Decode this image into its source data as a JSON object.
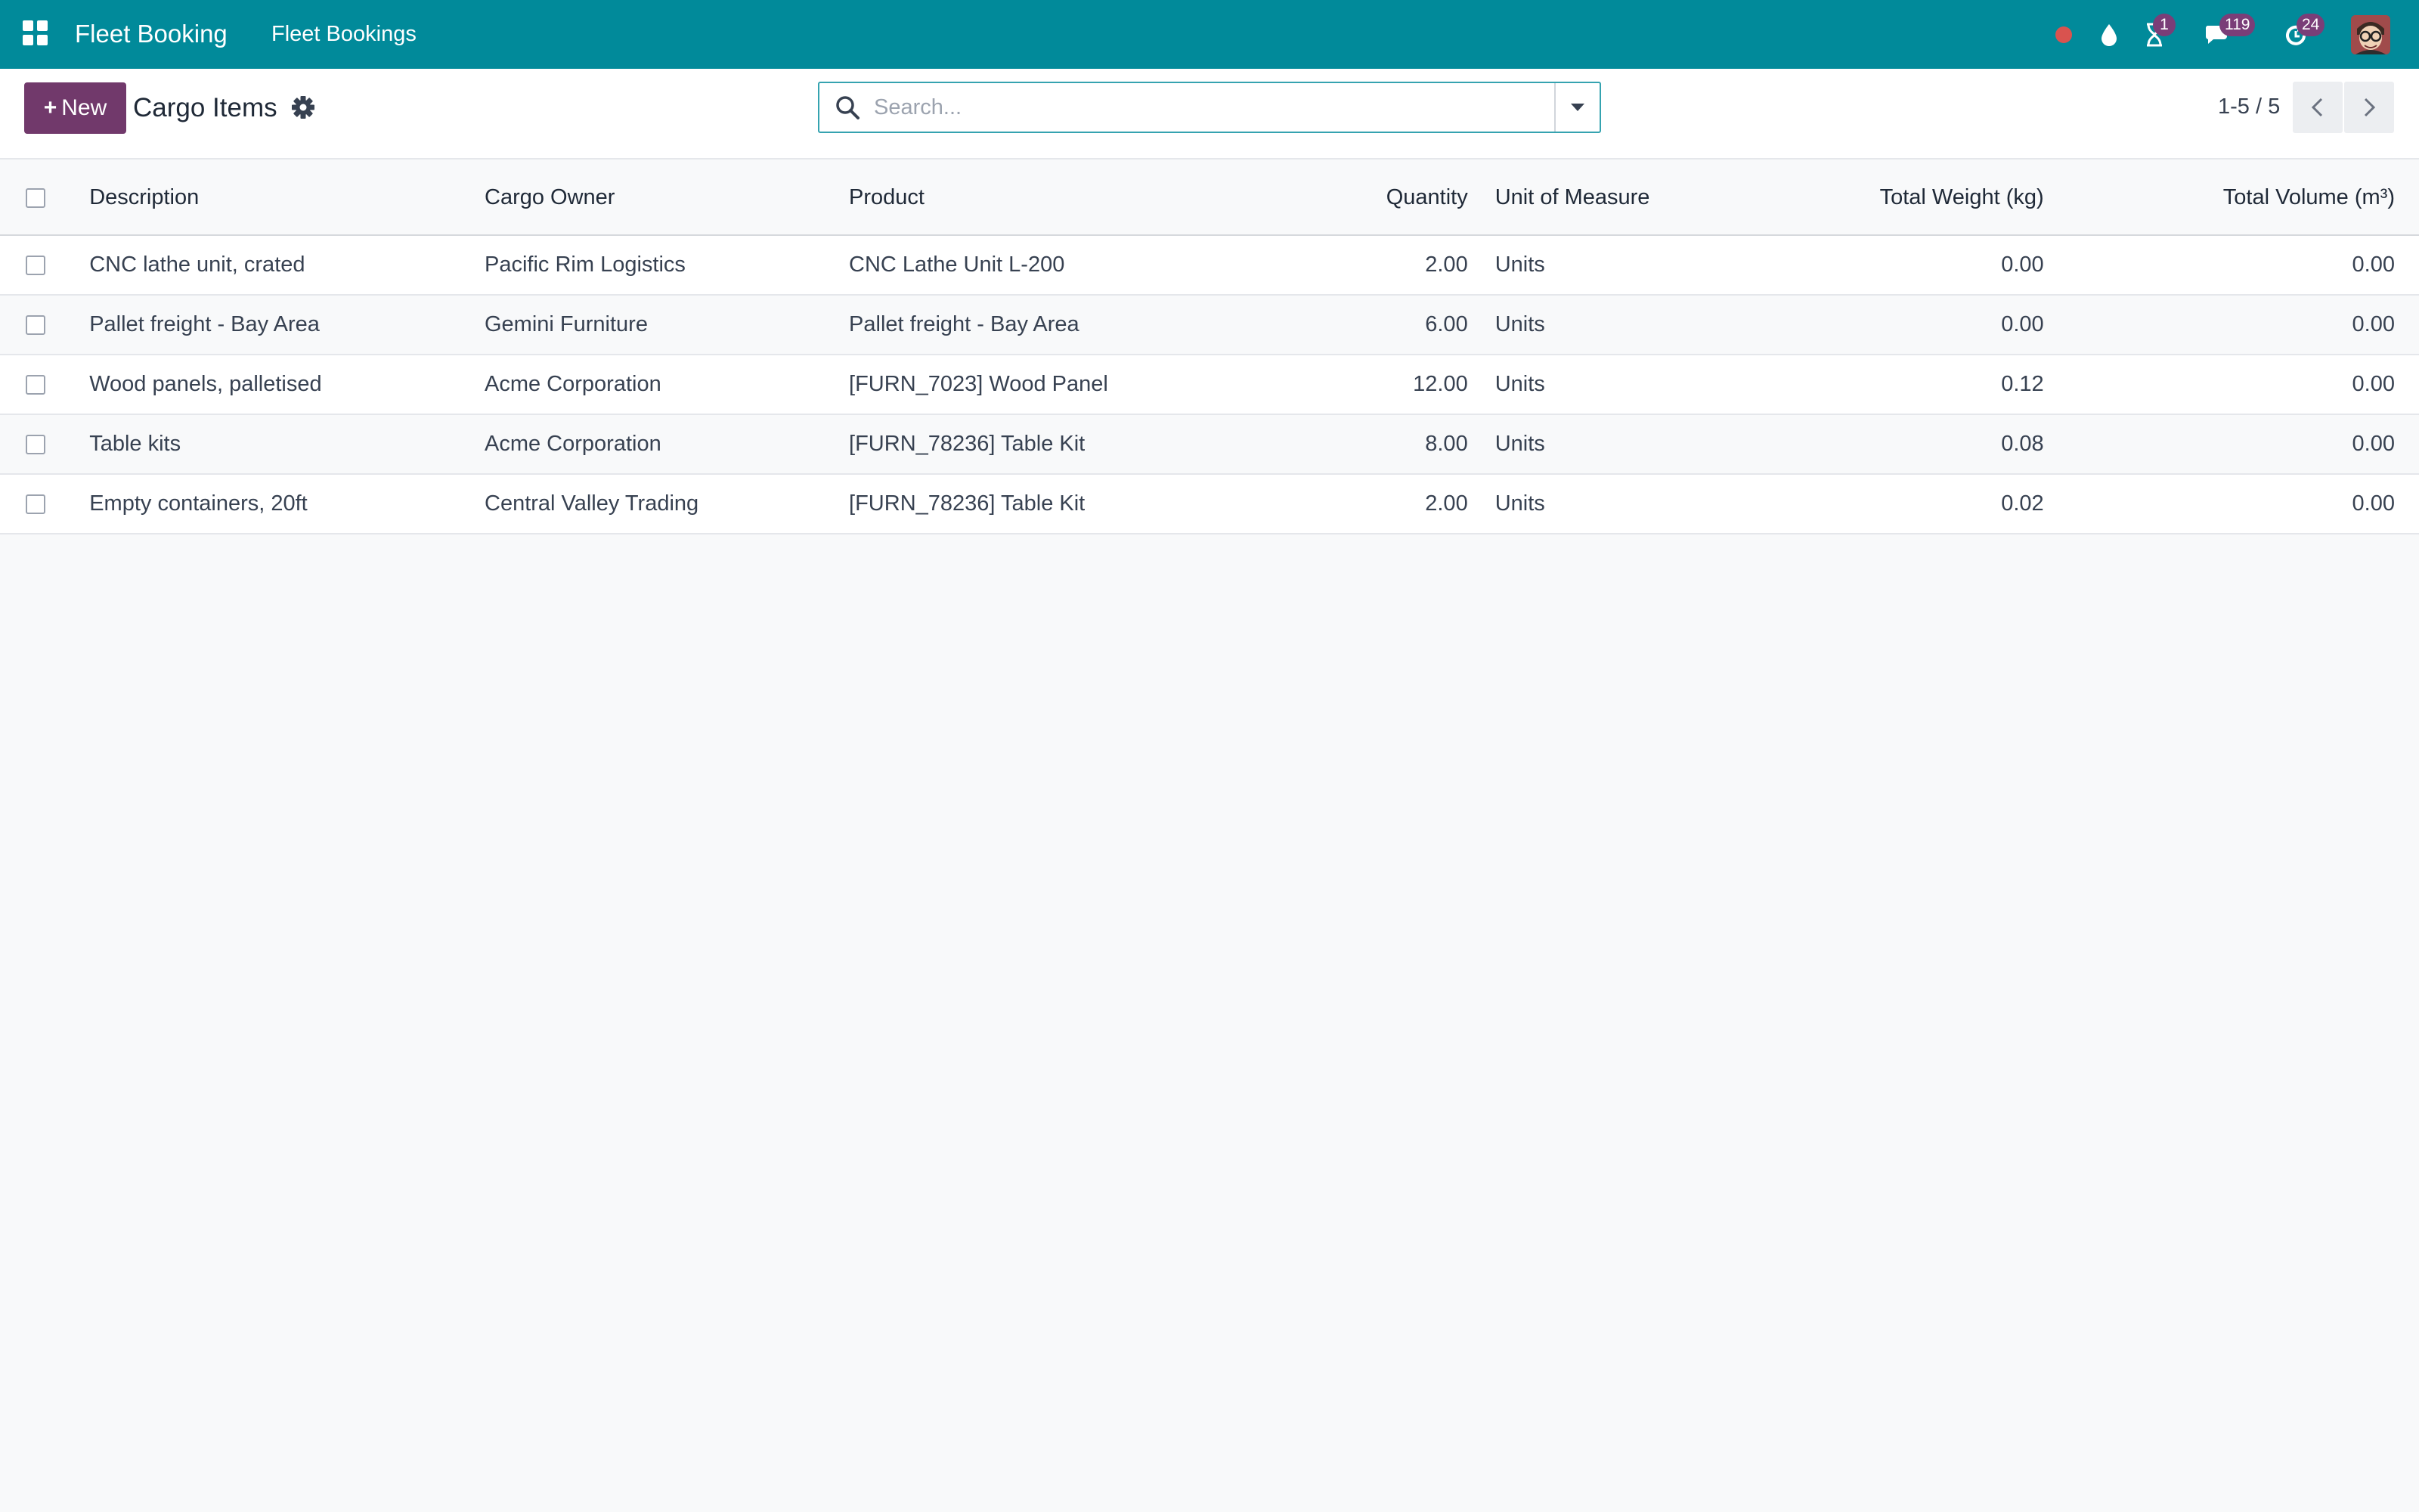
{
  "navbar": {
    "app_name": "Fleet Booking",
    "menu_label": "Fleet Bookings",
    "activity_count": "1",
    "messages_count": "119",
    "updates_count": "24"
  },
  "control_panel": {
    "new_button": "New",
    "title": "Cargo Items",
    "search_placeholder": "Search...",
    "pager": "1-5 / 5"
  },
  "table": {
    "columns": {
      "description": "Description",
      "cargo_owner": "Cargo Owner",
      "product": "Product",
      "quantity": "Quantity",
      "uom": "Unit of Measure",
      "total_weight": "Total Weight (kg)",
      "total_volume": "Total Volume (m³)"
    },
    "rows": [
      {
        "description": "CNC lathe unit, crated",
        "cargo_owner": "Pacific Rim Logistics",
        "product": "CNC Lathe Unit L-200",
        "quantity": "2.00",
        "uom": "Units",
        "total_weight": "0.00",
        "total_volume": "0.00"
      },
      {
        "description": "Pallet freight - Bay Area",
        "cargo_owner": "Gemini Furniture",
        "product": "Pallet freight - Bay Area",
        "quantity": "6.00",
        "uom": "Units",
        "total_weight": "0.00",
        "total_volume": "0.00"
      },
      {
        "description": "Wood panels, palletised",
        "cargo_owner": "Acme Corporation",
        "product": "[FURN_7023] Wood Panel",
        "quantity": "12.00",
        "uom": "Units",
        "total_weight": "0.12",
        "total_volume": "0.00"
      },
      {
        "description": "Table kits",
        "cargo_owner": "Acme Corporation",
        "product": "[FURN_78236] Table Kit",
        "quantity": "8.00",
        "uom": "Units",
        "total_weight": "0.08",
        "total_volume": "0.00"
      },
      {
        "description": "Empty containers, 20ft",
        "cargo_owner": "Central Valley Trading",
        "product": "[FURN_78236] Table Kit",
        "quantity": "2.00",
        "uom": "Units",
        "total_weight": "0.02",
        "total_volume": "0.00"
      }
    ]
  },
  "colors": {
    "navbar": "#018a9a",
    "primary_button": "#71396b",
    "badge": "#7a3e78",
    "recording_dot": "#d9534f"
  },
  "icons": [
    "apps-grid-icon",
    "record-dot-icon",
    "drop-icon",
    "hourglass-icon",
    "chat-icon",
    "refresh-clock-icon",
    "user-avatar",
    "gear-icon",
    "search-icon",
    "caret-down-icon",
    "chevron-left-icon",
    "chevron-right-icon"
  ]
}
